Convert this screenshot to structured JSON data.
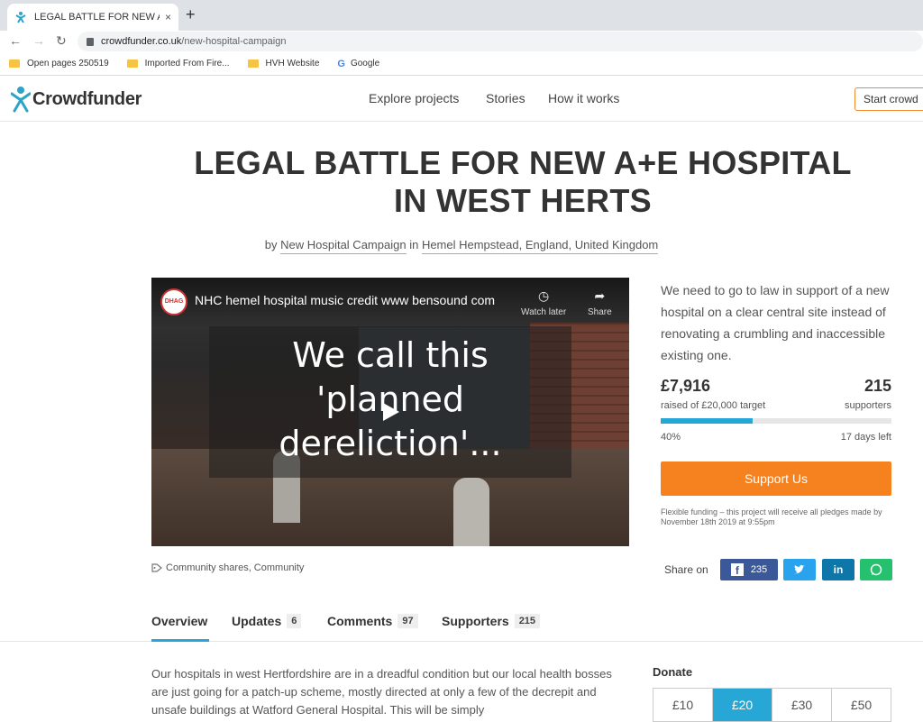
{
  "browser": {
    "tab_title": "LEGAL BATTLE FOR NEW A+E HO",
    "tab_close": "×",
    "new_tab": "+",
    "url_domain": "crowdfunder.co.uk",
    "url_path": "/new-hospital-campaign",
    "bookmarks": [
      "Open pages 250519",
      "Imported From Fire...",
      "HVH Website",
      "Google"
    ]
  },
  "header": {
    "logo": "Crowdfunder",
    "nav": [
      "Explore projects",
      "Stories",
      "How it works"
    ],
    "start_button": "Start crowd"
  },
  "project": {
    "title_line1": "LEGAL BATTLE FOR NEW A+E HOSPITAL",
    "title_line2": "IN WEST HERTS",
    "by": "by",
    "creator": "New Hospital Campaign",
    "in": "in",
    "location": "Hemel Hempstead, England, United Kingdom"
  },
  "video": {
    "channel_badge": "DHAG",
    "title": "NHC hemel hospital music credit www bensound com",
    "watch_later": "Watch later",
    "share": "Share",
    "caption_lines": [
      "We call this",
      "'planned",
      "dereliction'..."
    ]
  },
  "sidebar": {
    "blurb": "We need to go to law in support of a new hospital on a clear central site instead of renovating a crumbling and inaccessible existing one.",
    "raised": "£7,916",
    "target": "raised of £20,000 target",
    "supporters_count": "215",
    "supporters_label": "supporters",
    "progress_fraction": 0.4,
    "percent": "40%",
    "days_left": "17 days left",
    "support_button": "Support Us",
    "flex_note": "Flexible funding – this project will receive all pledges made by November 18th 2019 at 9:55pm",
    "share_label": "Share on",
    "facebook_count": "235"
  },
  "tags": "Community shares, Community",
  "tabs": [
    {
      "label": "Overview"
    },
    {
      "label": "Updates",
      "count": "6"
    },
    {
      "label": "Comments",
      "count": "97"
    },
    {
      "label": "Supporters",
      "count": "215"
    }
  ],
  "story": "Our hospitals in west Hertfordshire are in a dreadful condition but our local health bosses are just going for a patch-up scheme, mostly directed at only a few of the decrepit and unsafe buildings at Watford General Hospital.   This will be simply",
  "donate": {
    "title": "Donate",
    "amounts": [
      "£10",
      "£20",
      "£30",
      "£50"
    ],
    "selected_index": 1
  },
  "colors": {
    "accent_blue": "#26a7d6",
    "support_orange": "#f5821f",
    "facebook": "#3b5998",
    "twitter": "#2aa3ef",
    "linkedin": "#0e76a8",
    "whatsapp": "#25c16f"
  }
}
